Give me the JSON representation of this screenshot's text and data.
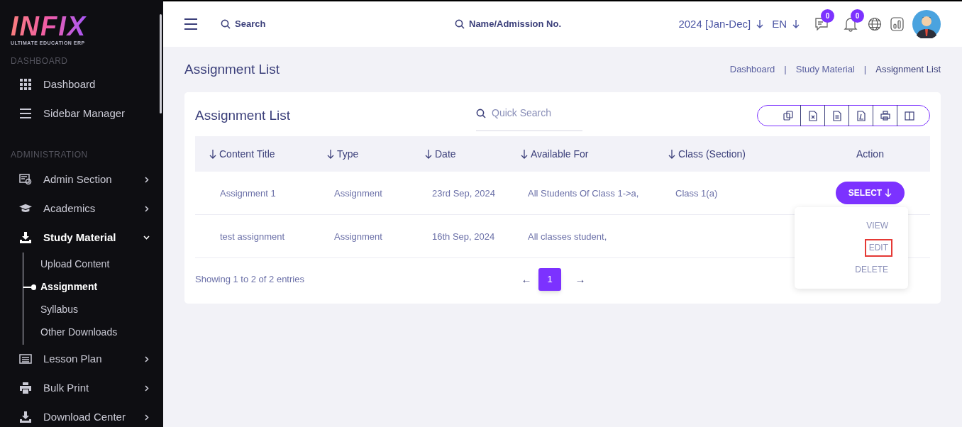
{
  "sidebar": {
    "logo": "INFIX",
    "tagline": "ULTIMATE EDUCATION ERP",
    "sections": [
      {
        "title": "DASHBOARD",
        "items": [
          {
            "label": "Dashboard",
            "active": false
          },
          {
            "label": "Sidebar Manager",
            "active": false
          }
        ]
      },
      {
        "title": "ADMINISTRATION",
        "items": [
          {
            "label": "Admin Section",
            "expanded": false,
            "active": false
          },
          {
            "label": "Academics",
            "expanded": false,
            "active": false
          },
          {
            "label": "Study Material",
            "expanded": true,
            "active": true,
            "children": [
              {
                "label": "Upload Content",
                "selected": false
              },
              {
                "label": "Assignment",
                "selected": true
              },
              {
                "label": "Syllabus",
                "selected": false
              },
              {
                "label": "Other Downloads",
                "selected": false
              }
            ]
          },
          {
            "label": "Lesson Plan",
            "expanded": false,
            "active": false
          },
          {
            "label": "Bulk Print",
            "expanded": false,
            "active": false
          },
          {
            "label": "Download Center",
            "expanded": false,
            "active": false
          }
        ]
      }
    ]
  },
  "header": {
    "search": "Search",
    "student_search": "Name/Admission No.",
    "session": "2024 [Jan-Dec]",
    "language": "EN",
    "message_count": "0",
    "notification_count": "0"
  },
  "page": {
    "title": "Assignment List",
    "breadcrumbs": [
      {
        "kind": "link",
        "text": "Dashboard"
      },
      {
        "kind": "separator",
        "text": "|"
      },
      {
        "kind": "link",
        "text": "Study Material"
      },
      {
        "kind": "separator",
        "text": "|"
      },
      {
        "kind": "current",
        "text": "Assignment List"
      }
    ]
  },
  "card": {
    "title": "Assignment List",
    "quick_search": {
      "placeholder": "Quick Search"
    },
    "table": {
      "columns": [
        {
          "label": "Content Title",
          "sortable": true
        },
        {
          "label": "Type",
          "sortable": true
        },
        {
          "label": "Date",
          "sortable": true
        },
        {
          "label": "Available For",
          "sortable": true
        },
        {
          "label": "Class (Section)",
          "sortable": true
        },
        {
          "label": "Action",
          "sortable": false
        }
      ],
      "rows": [
        {
          "cells": [
            "Assignment 1",
            "Assignment",
            "23rd Sep, 2024",
            "All Students Of Class 1->a,",
            "Class 1(a)"
          ],
          "action": "SELECT",
          "menu_open": true
        },
        {
          "cells": [
            "test assignment",
            "Assignment",
            "16th Sep, 2024",
            "All classes student,",
            ""
          ]
        }
      ]
    },
    "action_menu": [
      {
        "label": "VIEW",
        "highlighted": false
      },
      {
        "label": "EDIT",
        "highlighted": true
      },
      {
        "label": "DELETE",
        "highlighted": false
      }
    ],
    "footer": "Showing 1 to 2 of 2 entries",
    "pagination": {
      "prev": "←",
      "next": "→",
      "pages": [
        {
          "label": "1",
          "selected": true
        }
      ]
    }
  }
}
